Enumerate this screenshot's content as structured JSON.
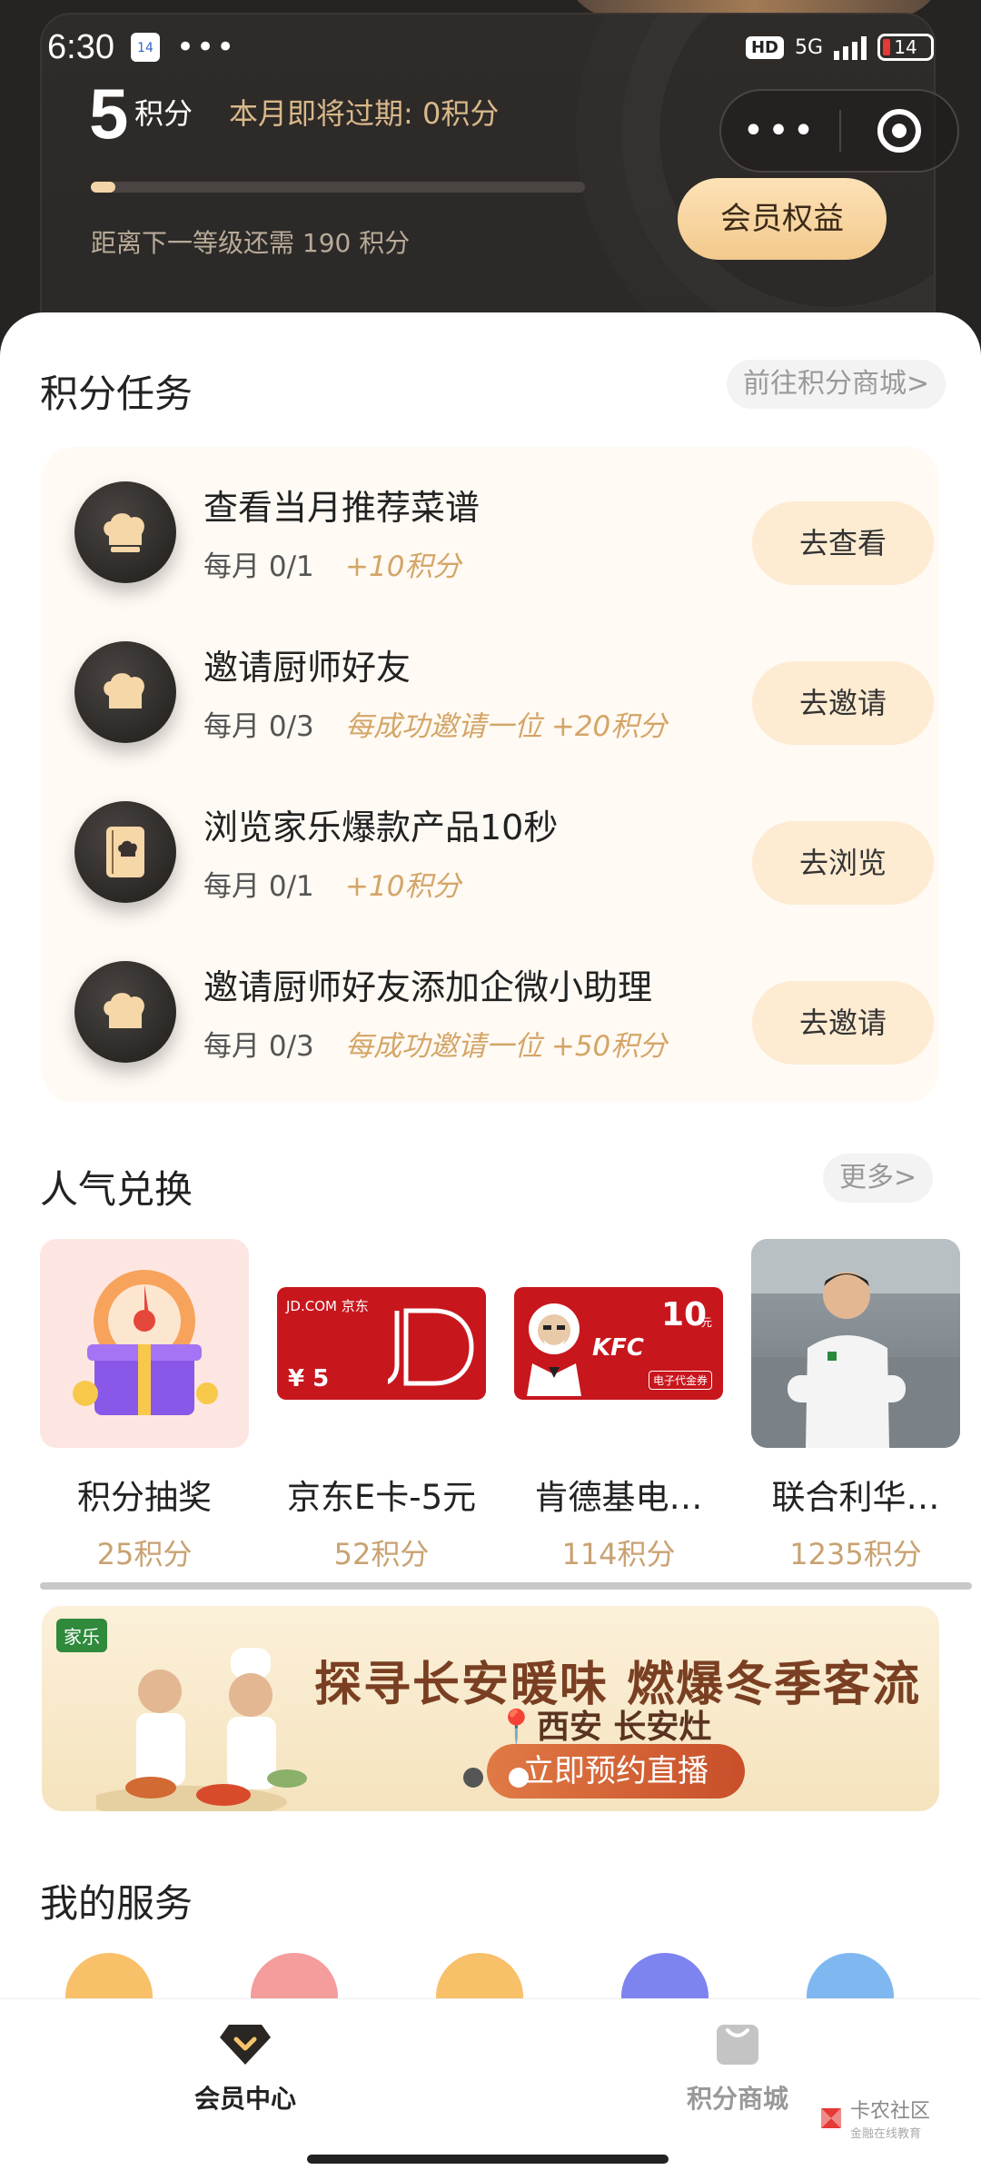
{
  "status_bar": {
    "time": "6:30",
    "calendar_day": "14",
    "hd": "HD",
    "network": "5G",
    "battery": "14"
  },
  "capsule": {
    "more": "•••"
  },
  "points": {
    "value": "5",
    "unit": "积分",
    "expire_text": "本月即将过期: 0积分",
    "progress_fraction": 0.05,
    "next_level_text": "距离下一等级还需 190 积分",
    "benefit_button": "会员权益"
  },
  "tasks_section": {
    "title": "积分任务",
    "link": "前往积分商城>",
    "items": [
      {
        "title": "查看当月推荐菜谱",
        "freq": "每月 0/1",
        "reward": "+10积分",
        "button": "去查看",
        "icon": "chef-hat-icon"
      },
      {
        "title": "邀请厨师好友",
        "freq": "每月 0/3",
        "reward": "每成功邀请一位 +20积分",
        "button": "去邀请",
        "icon": "chef-hat-icon"
      },
      {
        "title": "浏览家乐爆款产品10秒",
        "freq": "每月 0/1",
        "reward": "+10积分",
        "button": "去浏览",
        "icon": "recipe-book-icon"
      },
      {
        "title": "邀请厨师好友添加企微小助理",
        "freq": "每月 0/3",
        "reward": "每成功邀请一位 +50积分",
        "button": "去邀请",
        "icon": "chef-hat-icon"
      }
    ]
  },
  "exchange_section": {
    "title": "人气兑换",
    "link": "更多>",
    "goods": [
      {
        "name": "积分抽奖",
        "price": "25积分"
      },
      {
        "name": "京东E卡-5元",
        "price": "52积分",
        "card_brand": "JD.COM 京东",
        "card_value": "¥ 5"
      },
      {
        "name": "肯德基电…",
        "price": "114积分",
        "card_brand": "KFC",
        "card_value": "10",
        "card_unit": "元",
        "card_note": "电子代金券"
      },
      {
        "name": "联合利华…",
        "price": "1235积分"
      }
    ]
  },
  "banner": {
    "title": "探寻长安暖味 燃爆冬季客流",
    "location": "西安 长安灶",
    "cta": "立即预约直播",
    "brand": "家乐"
  },
  "services_section": {
    "title": "我的服务"
  },
  "tabbar": {
    "items": [
      {
        "label": "会员中心",
        "active": true
      },
      {
        "label": "积分商城",
        "active": false
      }
    ]
  },
  "watermark": {
    "title": "卡农社区",
    "subtitle": "金融在线教育"
  },
  "colors": {
    "accent_gold": "#d4a567",
    "dark_bg": "#262422",
    "button_cream": "#fdebd2"
  }
}
